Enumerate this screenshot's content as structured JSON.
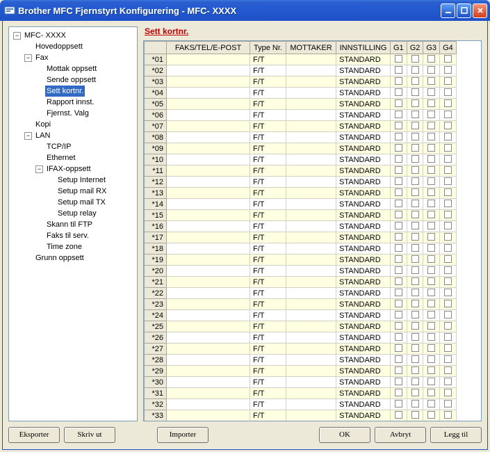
{
  "window": {
    "title": "Brother MFC Fjernstyrt Konfigurering - MFC-   XXXX"
  },
  "tree": {
    "root": "MFC-   XXXX",
    "items": {
      "hovedoppsett": "Hovedoppsett",
      "fax": "Fax",
      "mottak": "Mottak oppsett",
      "sende": "Sende oppsett",
      "settkortnr": "Sett kortnr.",
      "rapport": "Rapport innst.",
      "fjernst": "Fjernst. Valg",
      "kopi": "Kopi",
      "lan": "LAN",
      "tcpip": "TCP/IP",
      "ethernet": "Ethernet",
      "ifax": "IFAX-oppsett",
      "setupinternet": "Setup Internet",
      "setupmailrx": "Setup mail RX",
      "setupmailtx": "Setup mail TX",
      "setuprelay": "Setup relay",
      "skannftp": "Skann til FTP",
      "faksserv": "Faks til serv.",
      "timezone": "Time zone",
      "grunn": "Grunn oppsett"
    }
  },
  "page": {
    "heading": "Sett kortnr."
  },
  "table": {
    "headers": {
      "fte": "FAKS/TEL/E-POST",
      "type": "Type Nr.",
      "mottaker": "MOTTAKER",
      "innstilling": "INNSTILLING",
      "g1": "G1",
      "g2": "G2",
      "g3": "G3",
      "g4": "G4"
    },
    "type_default": "F/T",
    "innst_default": "STANDARD",
    "row_count": 33
  },
  "buttons": {
    "eksporter": "Eksporter",
    "skrivut": "Skriv ut",
    "importer": "Importer",
    "ok": "OK",
    "avbryt": "Avbryt",
    "leggtil": "Legg til"
  }
}
